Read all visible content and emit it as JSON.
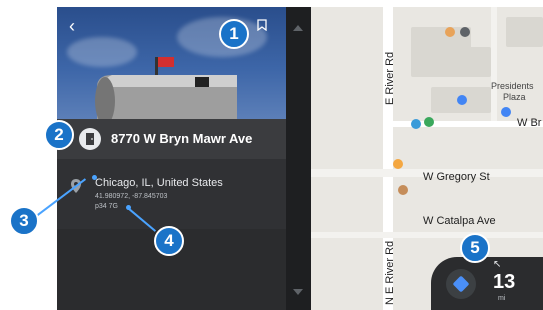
{
  "panel": {
    "back_glyph": "‹",
    "address": "8770 W Bryn Mawr Ave",
    "city": "Chicago, IL, United States",
    "coordinates": "41.980972, -87.845703",
    "plus_code": "p34 7G"
  },
  "map": {
    "road_e_river": "E River Rd",
    "road_n_e_river": "N E River Rd",
    "road_w_gregory": "W Gregory St",
    "road_w_catalpa": "W Catalpa Ave",
    "road_w_br": "W Br",
    "place_presidents": "Presidents",
    "place_plaza": "Plaza"
  },
  "navigation": {
    "distance": "13",
    "unit": "mi",
    "turn_glyph": "↖"
  },
  "callouts": [
    "1",
    "2",
    "3",
    "4",
    "5"
  ],
  "colors": {
    "callout_blue": "#1a73c8",
    "map_bg": "#e9e7e2",
    "panel_bg": "#2b2c2e",
    "nav_blue": "#4a8ff7"
  }
}
